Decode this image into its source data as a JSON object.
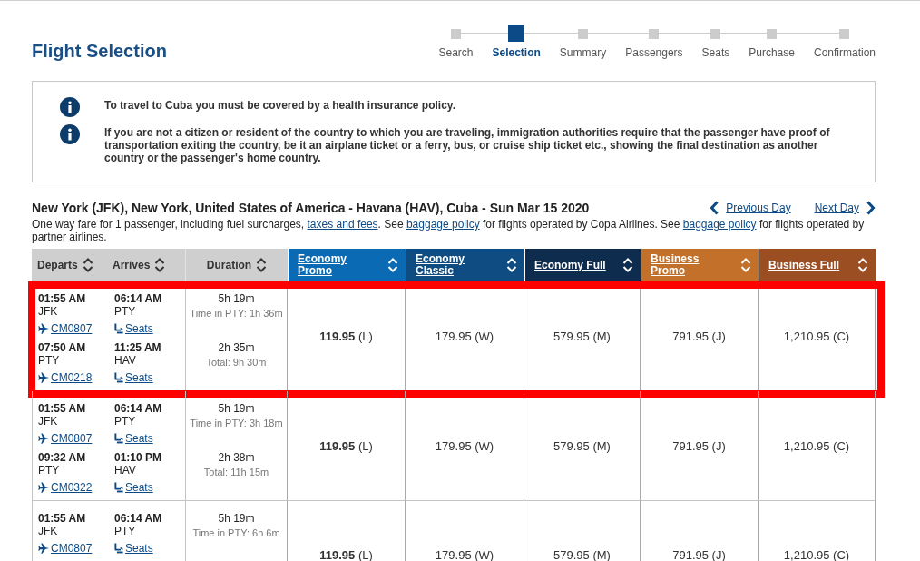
{
  "page": {
    "title": "Flight Selection"
  },
  "steps": [
    {
      "label": "Search",
      "selected": false
    },
    {
      "label": "Selection",
      "selected": true
    },
    {
      "label": "Summary",
      "selected": false
    },
    {
      "label": "Passengers",
      "selected": false
    },
    {
      "label": "Seats",
      "selected": false
    },
    {
      "label": "Purchase",
      "selected": false
    },
    {
      "label": "Confirmation",
      "selected": false
    }
  ],
  "notices": [
    "To travel to Cuba you must be covered by a health insurance policy.",
    "If you are not a citizen or resident of the country to which you are traveling, immigration authorities require that the passenger have proof of transportation exiting the country, be it an airplane ticket or a ferry, bus, or cruise ship ticket etc., showing the final destination as another country or the passenger's home country."
  ],
  "route": {
    "title": "New York (JFK), New York, United States of America - Havana (HAV), Cuba - Sun Mar 15 2020",
    "previous_day": "Previous Day",
    "next_day": "Next Day",
    "fare_note": [
      {
        "kind": "text",
        "text": "One way fare for 1 passenger, including fuel surcharges, "
      },
      {
        "kind": "link",
        "text": "taxes and fees"
      },
      {
        "kind": "text",
        "text": ". See "
      },
      {
        "kind": "link",
        "text": "baggage policy"
      },
      {
        "kind": "text",
        "text": " for flights operated by Copa Airlines. See "
      },
      {
        "kind": "link",
        "text": "baggage policy"
      },
      {
        "kind": "text",
        "text": " for flights operated by partner airlines."
      }
    ]
  },
  "table": {
    "columns": [
      {
        "label": "Departs",
        "kind": "sort"
      },
      {
        "label": "Arrives",
        "kind": "sort"
      },
      {
        "label": "Duration",
        "kind": "sort"
      },
      {
        "label": "Economy Promo",
        "kind": "fare",
        "color": "#0a6ab3"
      },
      {
        "label": "Economy Classic",
        "kind": "fare",
        "color": "#0f4c81"
      },
      {
        "label": "Economy Full",
        "kind": "fare",
        "color": "#0d2c4e"
      },
      {
        "label": "Business Promo",
        "kind": "fare",
        "color": "#c2702a"
      },
      {
        "label": "Business Full",
        "kind": "fare",
        "color": "#9c4e23"
      }
    ],
    "rows": [
      {
        "highlighted": true,
        "legs": [
          {
            "depart_time": "01:55 AM",
            "depart_airport": "JFK",
            "flight": "CM0807",
            "arrive_time": "06:14 AM",
            "arrive_airport": "PTY",
            "seats": "Seats",
            "duration": "5h 19m",
            "note": "Time in PTY: 1h 36m"
          },
          {
            "depart_time": "07:50 AM",
            "depart_airport": "PTY",
            "flight": "CM0218",
            "arrive_time": "11:25 AM",
            "arrive_airport": "HAV",
            "seats": "Seats",
            "duration": "2h 35m",
            "note": "Total: 9h 30m"
          }
        ],
        "fares": [
          "**119.95** (L)",
          "179.95 (W)",
          "579.95 (M)",
          "791.95 (J)",
          "1,210.95 (C)"
        ]
      },
      {
        "highlighted": false,
        "legs": [
          {
            "depart_time": "01:55 AM",
            "depart_airport": "JFK",
            "flight": "CM0807",
            "arrive_time": "06:14 AM",
            "arrive_airport": "PTY",
            "seats": "Seats",
            "duration": "5h 19m",
            "note": "Time in PTY: 3h 18m"
          },
          {
            "depart_time": "09:32 AM",
            "depart_airport": "PTY",
            "flight": "CM0322",
            "arrive_time": "01:10 PM",
            "arrive_airport": "HAV",
            "seats": "Seats",
            "duration": "2h 38m",
            "note": "Total: 11h 15m"
          }
        ],
        "fares": [
          "**119.95** (L)",
          "179.95 (W)",
          "579.95 (M)",
          "791.95 (J)",
          "1,210.95 (C)"
        ]
      },
      {
        "highlighted": false,
        "legs": [
          {
            "depart_time": "01:55 AM",
            "depart_airport": "JFK",
            "flight": "CM0807",
            "arrive_time": "06:14 AM",
            "arrive_airport": "PTY",
            "seats": "Seats",
            "duration": "5h 19m",
            "note": "Time in PTY: 6h 6m"
          }
        ],
        "fares": [
          "**119.95** (L)",
          "179.95 (W)",
          "579.95 (M)",
          "791.95 (J)",
          "1,210.95 (C)"
        ]
      }
    ]
  }
}
